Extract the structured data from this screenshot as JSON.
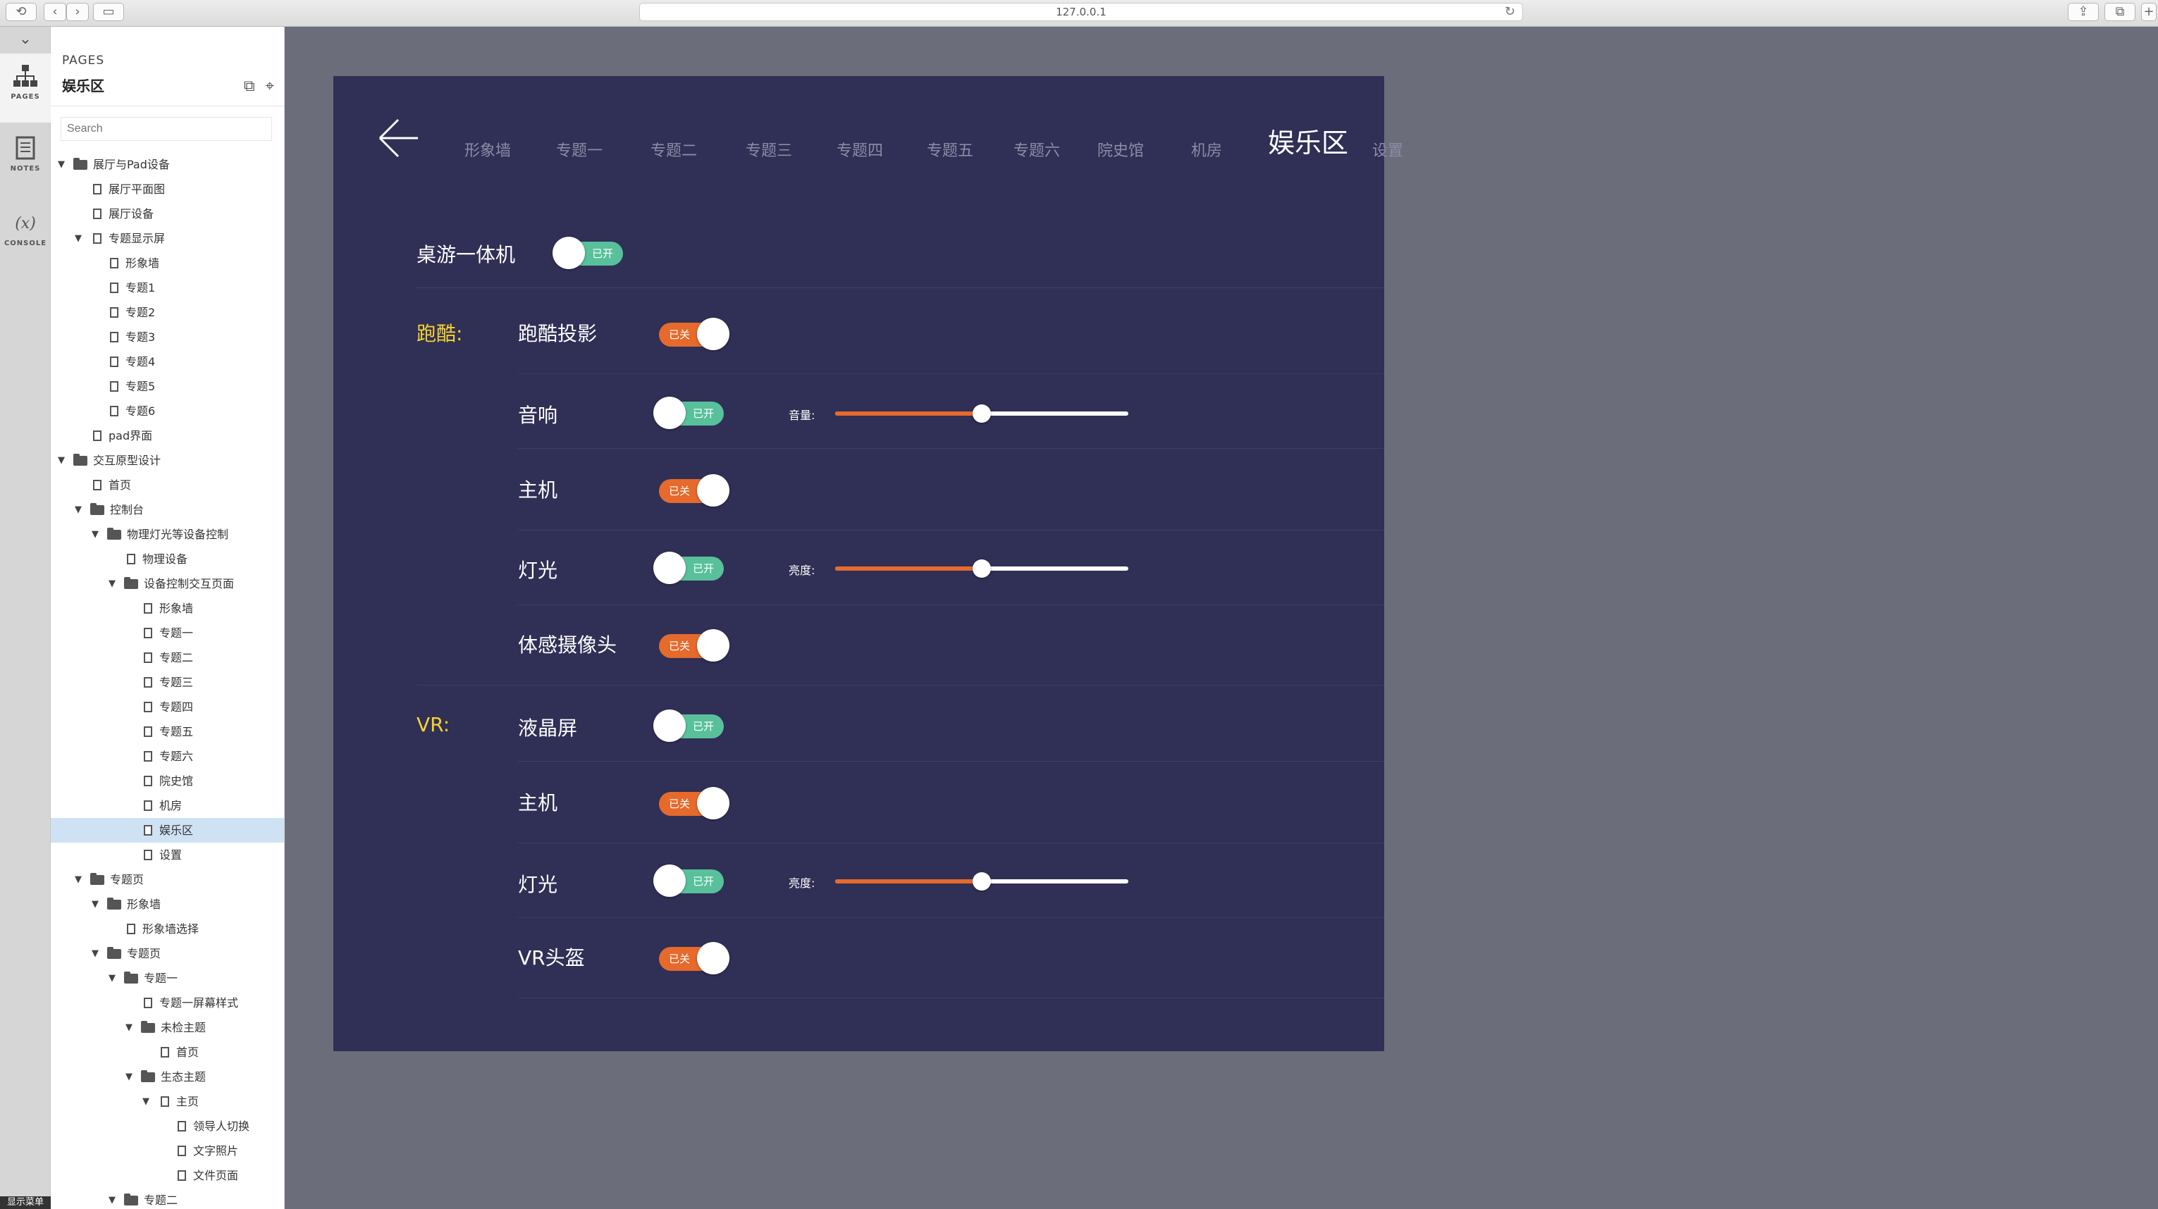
{
  "browser": {
    "url": "127.0.0.1"
  },
  "strip": {
    "tabs": [
      {
        "label": "PAGES",
        "icon": "sitemap-icon"
      },
      {
        "label": "NOTES",
        "icon": "notes-icon"
      },
      {
        "label": "CONSOLE",
        "icon": "console-icon"
      }
    ],
    "footer": "显示菜单"
  },
  "sidebar": {
    "caption": "PAGES",
    "page_title": "娱乐区",
    "search_placeholder": "Search",
    "tree": [
      {
        "label": "展厅与Pad设备",
        "level": 0,
        "type": "folder",
        "expanded": true
      },
      {
        "label": "展厅平面图",
        "level": 1,
        "type": "page"
      },
      {
        "label": "展厅设备",
        "level": 1,
        "type": "page"
      },
      {
        "label": "专题显示屏",
        "level": 1,
        "type": "page",
        "expanded": true
      },
      {
        "label": "形象墙",
        "level": 2,
        "type": "page"
      },
      {
        "label": "专题1",
        "level": 2,
        "type": "page"
      },
      {
        "label": "专题2",
        "level": 2,
        "type": "page"
      },
      {
        "label": "专题3",
        "level": 2,
        "type": "page"
      },
      {
        "label": "专题4",
        "level": 2,
        "type": "page"
      },
      {
        "label": "专题5",
        "level": 2,
        "type": "page"
      },
      {
        "label": "专题6",
        "level": 2,
        "type": "page"
      },
      {
        "label": "pad界面",
        "level": 1,
        "type": "page"
      },
      {
        "label": "交互原型设计",
        "level": 0,
        "type": "folder",
        "expanded": true
      },
      {
        "label": "首页",
        "level": 1,
        "type": "page"
      },
      {
        "label": "控制台",
        "level": 1,
        "type": "folder",
        "expanded": true
      },
      {
        "label": "物理灯光等设备控制",
        "level": 2,
        "type": "folder",
        "expanded": true
      },
      {
        "label": "物理设备",
        "level": 3,
        "type": "page"
      },
      {
        "label": "设备控制交互页面",
        "level": 3,
        "type": "folder",
        "expanded": true
      },
      {
        "label": "形象墙",
        "level": 4,
        "type": "page"
      },
      {
        "label": "专题一",
        "level": 4,
        "type": "page"
      },
      {
        "label": "专题二",
        "level": 4,
        "type": "page"
      },
      {
        "label": "专题三",
        "level": 4,
        "type": "page"
      },
      {
        "label": "专题四",
        "level": 4,
        "type": "page"
      },
      {
        "label": "专题五",
        "level": 4,
        "type": "page"
      },
      {
        "label": "专题六",
        "level": 4,
        "type": "page"
      },
      {
        "label": "院史馆",
        "level": 4,
        "type": "page"
      },
      {
        "label": "机房",
        "level": 4,
        "type": "page"
      },
      {
        "label": "娱乐区",
        "level": 4,
        "type": "page",
        "selected": true
      },
      {
        "label": "设置",
        "level": 4,
        "type": "page"
      },
      {
        "label": "专题页",
        "level": 1,
        "type": "folder",
        "expanded": true
      },
      {
        "label": "形象墙",
        "level": 2,
        "type": "folder",
        "expanded": true
      },
      {
        "label": "形象墙选择",
        "level": 3,
        "type": "page"
      },
      {
        "label": "专题页",
        "level": 2,
        "type": "folder",
        "expanded": true
      },
      {
        "label": "专题一",
        "level": 3,
        "type": "folder",
        "expanded": true
      },
      {
        "label": "专题一屏幕样式",
        "level": 4,
        "type": "page"
      },
      {
        "label": "未检主题",
        "level": 4,
        "type": "folder",
        "expanded": true
      },
      {
        "label": "首页",
        "level": 5,
        "type": "page"
      },
      {
        "label": "生态主题",
        "level": 4,
        "type": "folder",
        "expanded": true
      },
      {
        "label": "主页",
        "level": 5,
        "type": "page",
        "expanded": true
      },
      {
        "label": "领导人切换",
        "level": 6,
        "type": "page"
      },
      {
        "label": "文字照片",
        "level": 6,
        "type": "page"
      },
      {
        "label": "文件页面",
        "level": 6,
        "type": "page"
      },
      {
        "label": "专题二",
        "level": 3,
        "type": "folder",
        "expanded": true
      }
    ]
  },
  "proto": {
    "nav": [
      {
        "label": "形象墙"
      },
      {
        "label": "专题一"
      },
      {
        "label": "专题二"
      },
      {
        "label": "专题三"
      },
      {
        "label": "专题四"
      },
      {
        "label": "专题五"
      },
      {
        "label": "专题六"
      },
      {
        "label": "院史馆"
      },
      {
        "label": "机房"
      },
      {
        "label": "娱乐区",
        "active": true
      },
      {
        "label": "设置"
      }
    ],
    "sections": {
      "parkour": "跑酷:",
      "vr": "VR:"
    },
    "toggle_text": {
      "on": "已开",
      "off": "已关"
    },
    "rows": [
      {
        "label": "桌游一体机",
        "state": "on"
      },
      {
        "label": "跑酷投影",
        "state": "off"
      },
      {
        "label": "音响",
        "state": "on",
        "slider_label": "音量:",
        "slider_value": 50
      },
      {
        "label": "主机",
        "state": "off"
      },
      {
        "label": "灯光",
        "state": "on",
        "slider_label": "亮度:",
        "slider_value": 50
      },
      {
        "label": "体感摄像头",
        "state": "off"
      },
      {
        "label": "液晶屏",
        "state": "on"
      },
      {
        "label": "主机",
        "state": "off"
      },
      {
        "label": "灯光",
        "state": "on",
        "slider_label": "亮度:",
        "slider_value": 50
      },
      {
        "label": "VR头盔",
        "state": "off"
      }
    ],
    "colors": {
      "background": "#302f55",
      "on": "#58c09b",
      "off": "#e56a2c",
      "section": "#f5d330",
      "slider_fill": "#e56a2c"
    }
  }
}
